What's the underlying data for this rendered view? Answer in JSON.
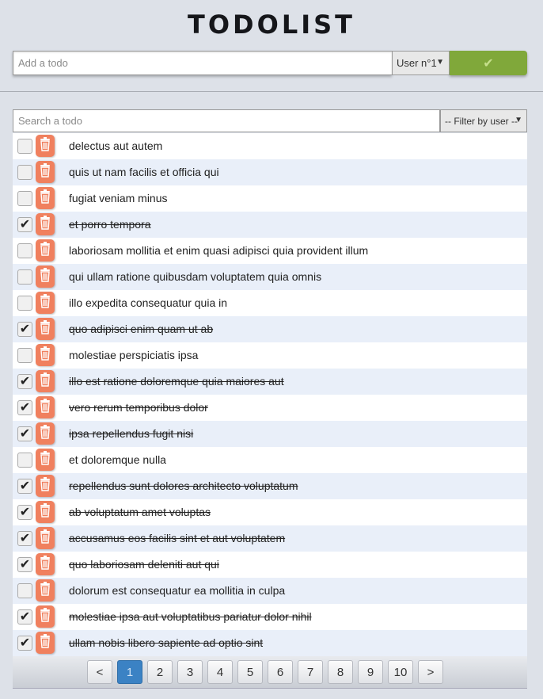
{
  "app": {
    "title": "TODOLIST"
  },
  "add_form": {
    "placeholder": "Add a todo",
    "user_select": "User n°1",
    "submit_icon": "check-icon"
  },
  "search": {
    "placeholder": "Search a todo",
    "filter_select": "-- Filter by user --"
  },
  "todos": [
    {
      "text": "delectus aut autem",
      "done": false
    },
    {
      "text": "quis ut nam facilis et officia qui",
      "done": false
    },
    {
      "text": "fugiat veniam minus",
      "done": false
    },
    {
      "text": "et porro tempora",
      "done": true
    },
    {
      "text": "laboriosam mollitia et enim quasi adipisci quia provident illum",
      "done": false
    },
    {
      "text": "qui ullam ratione quibusdam voluptatem quia omnis",
      "done": false
    },
    {
      "text": "illo expedita consequatur quia in",
      "done": false
    },
    {
      "text": "quo adipisci enim quam ut ab",
      "done": true
    },
    {
      "text": "molestiae perspiciatis ipsa",
      "done": false
    },
    {
      "text": "illo est ratione doloremque quia maiores aut",
      "done": true
    },
    {
      "text": "vero rerum temporibus dolor",
      "done": true
    },
    {
      "text": "ipsa repellendus fugit nisi",
      "done": true
    },
    {
      "text": "et doloremque nulla",
      "done": false
    },
    {
      "text": "repellendus sunt dolores architecto voluptatum",
      "done": true
    },
    {
      "text": "ab voluptatum amet voluptas",
      "done": true
    },
    {
      "text": "accusamus eos facilis sint et aut voluptatem",
      "done": true
    },
    {
      "text": "quo laboriosam deleniti aut qui",
      "done": true
    },
    {
      "text": "dolorum est consequatur ea mollitia in culpa",
      "done": false
    },
    {
      "text": "molestiae ipsa aut voluptatibus pariatur dolor nihil",
      "done": true
    },
    {
      "text": "ullam nobis libero sapiente ad optio sint",
      "done": true
    }
  ],
  "pagination": {
    "prev": "<",
    "next": ">",
    "pages": [
      "1",
      "2",
      "3",
      "4",
      "5",
      "6",
      "7",
      "8",
      "9",
      "10"
    ],
    "current": "1"
  },
  "colors": {
    "submit": "#80a83a",
    "delete": "#f0805e",
    "active_page": "#3b82c4"
  }
}
